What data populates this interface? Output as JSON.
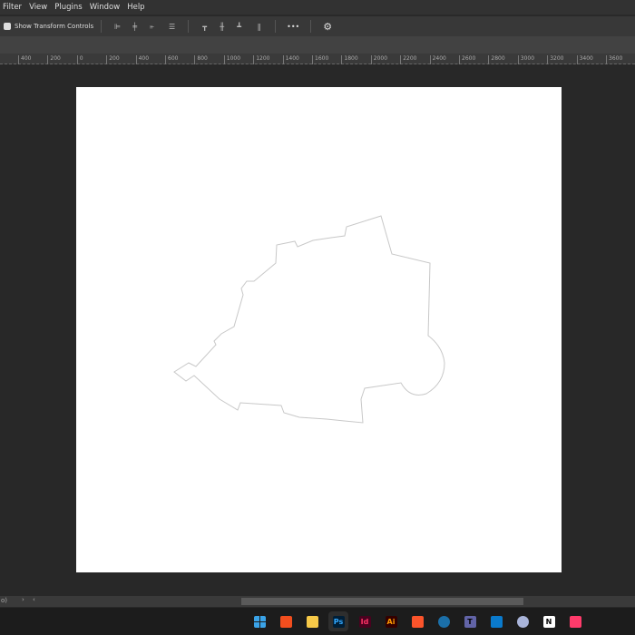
{
  "menu": {
    "items": [
      "Filter",
      "View",
      "Plugins",
      "Window",
      "Help"
    ]
  },
  "options": {
    "show_transform_controls": "Show Transform Controls",
    "checked": true,
    "more": "•••"
  },
  "ruler": {
    "labels": [
      "400",
      "200",
      "0",
      "200",
      "400",
      "600",
      "800",
      "1000",
      "1200",
      "1400",
      "1600",
      "1800",
      "2000",
      "2200",
      "2400",
      "2600",
      "2800",
      "3000",
      "3200",
      "3400",
      "3600"
    ]
  },
  "status": {
    "left": "o)",
    "next": "›",
    "prev": "‹"
  },
  "taskbar": {
    "apps": [
      {
        "name": "start",
        "label": "",
        "color": "#3aa3e8"
      },
      {
        "name": "figma",
        "label": "",
        "color": "#f24e1e"
      },
      {
        "name": "file-explorer",
        "label": "",
        "color": "#f7c948"
      },
      {
        "name": "photoshop",
        "label": "Ps",
        "color": "#31a8ff",
        "bg": "#001e36",
        "active": true
      },
      {
        "name": "indesign",
        "label": "Id",
        "color": "#ff3366",
        "bg": "#49021f"
      },
      {
        "name": "illustrator",
        "label": "Ai",
        "color": "#ff9a00",
        "bg": "#330000"
      },
      {
        "name": "brave",
        "label": "",
        "color": "#fb542b"
      },
      {
        "name": "steam",
        "label": "",
        "color": "#1b6fa8"
      },
      {
        "name": "teams",
        "label": "T",
        "color": "#6264a7"
      },
      {
        "name": "vscode",
        "label": "",
        "color": "#0a7acc"
      },
      {
        "name": "cinema4d",
        "label": "",
        "color": "#a9b4d9"
      },
      {
        "name": "notion",
        "label": "N",
        "color": "#ffffff"
      },
      {
        "name": "creative-cloud",
        "label": "",
        "color": "#ff3b6b"
      }
    ]
  }
}
